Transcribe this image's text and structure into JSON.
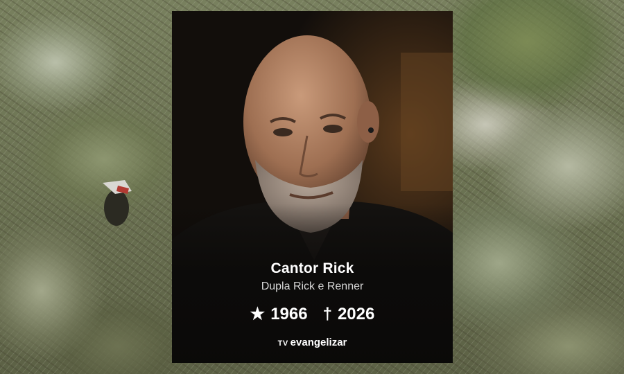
{
  "card": {
    "name": "Cantor Rick",
    "subtitle": "Dupla Rick e Renner",
    "birth_symbol": "★",
    "birth_year": "1966",
    "death_symbol": "†",
    "death_year": "2026",
    "brand_prefix": "TV",
    "brand_name": "evangelizar"
  },
  "colors": {
    "card_background": "#0e0c0b",
    "text": "#ffffff",
    "foliage": "#6b7252"
  }
}
